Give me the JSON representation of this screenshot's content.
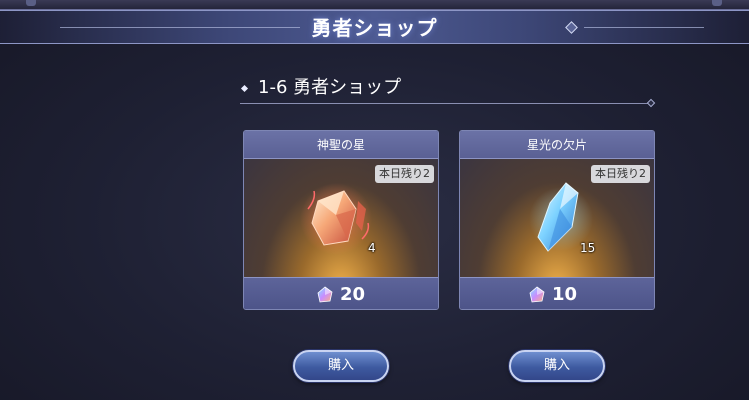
{
  "header": {
    "title": "勇者ショップ"
  },
  "section": {
    "title": "1-6 勇者ショップ"
  },
  "items": [
    {
      "name": "神聖の星",
      "remaining": "本日残り2",
      "quantity": "4",
      "price": "20",
      "icon": "holy-star-crystal-icon",
      "color": "#e8724a"
    },
    {
      "name": "星光の欠片",
      "remaining": "本日残り2",
      "quantity": "15",
      "price": "10",
      "icon": "starlight-shard-icon",
      "color": "#4fb4f0"
    }
  ],
  "currency_icon": "prism-gem-icon",
  "buy_label": "購入",
  "colors": {
    "header_accent": "#4d5a92",
    "card_head": "#6b72a6",
    "button": "#3e5aa0"
  }
}
